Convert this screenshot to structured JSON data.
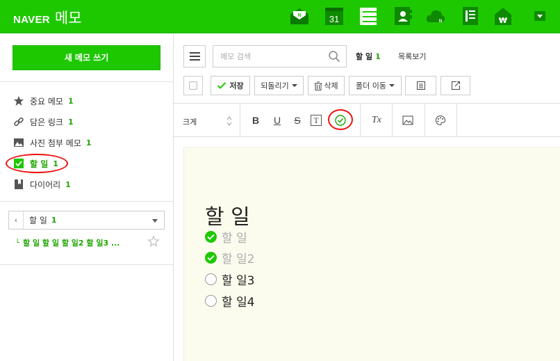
{
  "brand": {
    "logo": "NAVER",
    "title": "메모"
  },
  "app_icons": [
    {
      "name": "mail-icon",
      "label": "N"
    },
    {
      "name": "calendar-icon",
      "label": "31"
    },
    {
      "name": "memo-list-icon",
      "label": ""
    },
    {
      "name": "contacts-icon",
      "label": ""
    },
    {
      "name": "cloud-icon",
      "label": "N"
    },
    {
      "name": "office-icon",
      "label": ""
    },
    {
      "name": "household-ledger-icon",
      "label": "₩"
    },
    {
      "name": "more-apps-icon",
      "label": ""
    }
  ],
  "sidebar": {
    "new_memo_label": "새 메모 쓰기",
    "categories": [
      {
        "label": "중요 메모",
        "count": "1",
        "icon": "star-icon"
      },
      {
        "label": "담은 링크",
        "count": "1",
        "icon": "link-icon"
      },
      {
        "label": "사진 첨부 메모",
        "count": "1",
        "icon": "photo-icon"
      },
      {
        "label": "할 일",
        "count": "1",
        "icon": "checkbox-icon",
        "active": true
      },
      {
        "label": "다이어리",
        "count": "1",
        "icon": "bookmark-icon"
      }
    ],
    "folder": {
      "name": "할 일",
      "count": "1"
    },
    "memo_item": {
      "tree": "└",
      "title": "할 일 할 일 할 일2 할 일3 ..."
    }
  },
  "main": {
    "search_placeholder": "메모 검색",
    "view": {
      "todo_label": "할 일",
      "todo_count": "1",
      "list_label": "목록보기"
    },
    "toolbar": {
      "save": "저장",
      "undo": "되돌리기",
      "delete": "삭제",
      "move_folder": "폴더 이동"
    },
    "format": {
      "size_label": "크게",
      "bold": "B",
      "underline": "U",
      "strike": "S",
      "text": "T",
      "clear": "Tx"
    },
    "note": {
      "title": "할 일",
      "todos": [
        {
          "text": "할 일",
          "done": true
        },
        {
          "text": "할 일2",
          "done": true
        },
        {
          "text": "할 일3",
          "done": false
        },
        {
          "text": "할 일4",
          "done": false
        }
      ]
    }
  },
  "colors": {
    "brand_green": "#1ec800",
    "count_green": "#1ea500",
    "highlight_red": "#ee1111",
    "paper": "#fcfcee"
  }
}
